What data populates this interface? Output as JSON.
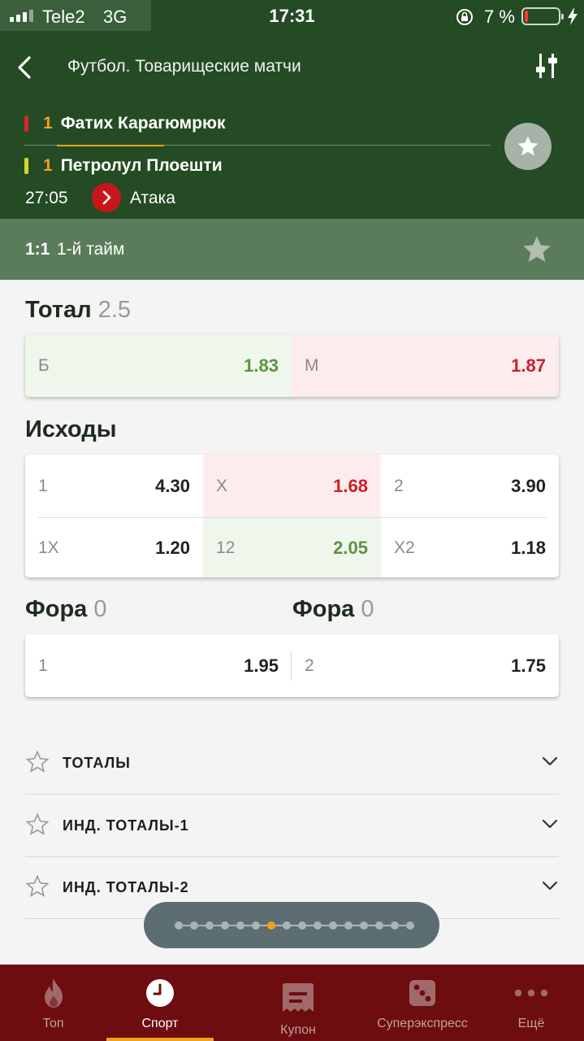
{
  "status_bar": {
    "carrier": "Tele2",
    "network": "3G",
    "time": "17:31",
    "battery_percent": "7 %",
    "battery_level": 0.07
  },
  "header": {
    "title": "Футбол. Товарищеские матчи",
    "team1": {
      "rank": "1",
      "name": "Фатих Карагюмрюк",
      "bar_color": "#d42a2a"
    },
    "team2": {
      "rank": "1",
      "name": "Петролул Плоешти",
      "bar_color": "#d6d62a"
    },
    "match_time": "27:05",
    "event": "Атака"
  },
  "scorebar": {
    "score": "1:1",
    "period": "1-й тайм"
  },
  "markets": {
    "total": {
      "title": "Тотал",
      "param": "2.5",
      "cells": [
        {
          "label": "Б",
          "odd": "1.83",
          "trend": "up"
        },
        {
          "label": "М",
          "odd": "1.87",
          "trend": "down"
        }
      ]
    },
    "outcomes": {
      "title": "Исходы",
      "rows": [
        [
          {
            "label": "1",
            "odd": "4.30",
            "trend": "none"
          },
          {
            "label": "X",
            "odd": "1.68",
            "trend": "down"
          },
          {
            "label": "2",
            "odd": "3.90",
            "trend": "none"
          }
        ],
        [
          {
            "label": "1X",
            "odd": "1.20",
            "trend": "none"
          },
          {
            "label": "12",
            "odd": "2.05",
            "trend": "up"
          },
          {
            "label": "X2",
            "odd": "1.18",
            "trend": "none"
          }
        ]
      ]
    },
    "handicap": {
      "title1": "Фора",
      "param1": "0",
      "title2": "Фора",
      "param2": "0",
      "cells": [
        {
          "label": "1",
          "odd": "1.95"
        },
        {
          "label": "2",
          "odd": "1.75"
        }
      ]
    }
  },
  "expandable": [
    {
      "label": "ТОТАЛЫ"
    },
    {
      "label": "ИНД. ТОТАЛЫ-1"
    },
    {
      "label": "ИНД. ТОТАЛЫ-2"
    }
  ],
  "pager": {
    "total": 16,
    "active": 6
  },
  "tabbar": {
    "tabs": [
      {
        "label": "Топ",
        "icon": "fire-icon"
      },
      {
        "label": "Спорт",
        "icon": "clock-icon",
        "active": true
      },
      {
        "label": "Купон",
        "icon": "coupon-icon"
      },
      {
        "label": "Суперэкспресс",
        "icon": "dice-icon"
      },
      {
        "label": "Ещё",
        "icon": "more-icon"
      }
    ]
  },
  "colors": {
    "header_bg": "#244b24",
    "scorebar_bg": "#5b7c5b",
    "accent": "#f0a21e",
    "odd_up": "#5f9146",
    "odd_down": "#cc1e2b",
    "tabbar_bg": "#6d0d10"
  }
}
